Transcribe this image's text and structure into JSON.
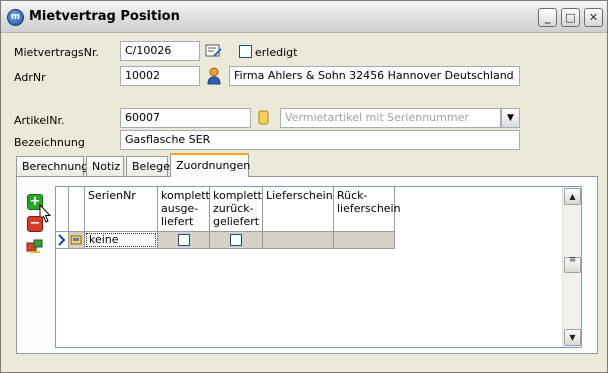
{
  "window": {
    "title": "Mietvertrag Position",
    "minimize": "_",
    "maximize": "□",
    "close": "✕"
  },
  "form": {
    "contract_label": "MietvertragsNr.",
    "contract_value": "C/10026",
    "done_label": "erledigt",
    "done_checked": false,
    "adr_label": "AdrNr",
    "adr_value": "10002",
    "adr_text": "Firma Ahlers & Sohn 32456 Hannover Deutschland",
    "article_label": "ArtikelNr.",
    "article_value": "60007",
    "article_type": "Vermietartikel mit Seriennummer",
    "desc_label": "Bezeichnung",
    "desc_value": "Gasflasche SER"
  },
  "tabs": [
    {
      "label": "Berechnung",
      "active": false
    },
    {
      "label": "Notiz",
      "active": false
    },
    {
      "label": "Belege",
      "active": false
    },
    {
      "label": "Zuordnungen",
      "active": true
    }
  ],
  "grid": {
    "columns": [
      {
        "label": "SerienNr"
      },
      {
        "label": "komplett ausge-liefert"
      },
      {
        "label": "komplett zurück-geliefert"
      },
      {
        "label": "Lieferschein"
      },
      {
        "label": "Rück-lieferschein"
      }
    ],
    "rows": [
      {
        "serial": "keine",
        "delivered": false,
        "returned": false,
        "delivery_note": "",
        "return_note": ""
      }
    ]
  },
  "icons": {
    "app": "app-icon",
    "lookup": "edit-lookup-icon",
    "person": "person-icon",
    "article": "article-tag-icon",
    "add": "plus-icon",
    "remove": "minus-icon",
    "assign": "assign-icon"
  }
}
